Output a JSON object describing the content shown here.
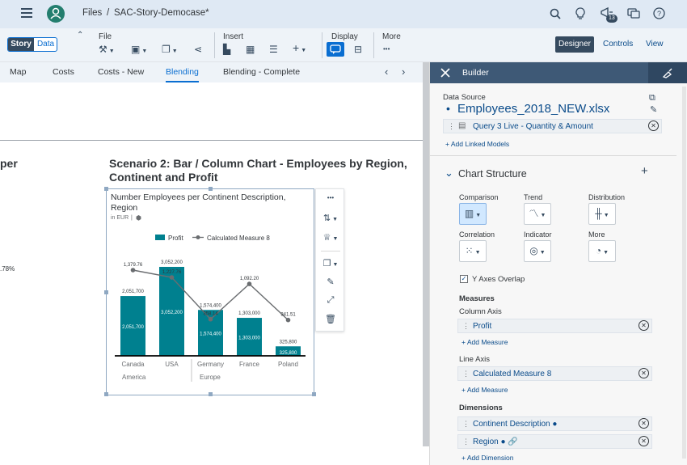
{
  "shell": {
    "menu_icon": "hamburger-icon",
    "nav_files": "Files",
    "nav_sep": "/",
    "story_title": "SAC-Story-Democase*",
    "notification_count": "13"
  },
  "toolbar": {
    "story_tab": "Story",
    "data_tab": "Data",
    "file_label": "File",
    "insert_label": "Insert",
    "display_label": "Display",
    "more_label": "More",
    "more_dots": "•••",
    "designer_label": "Designer",
    "controls_label": "Controls",
    "view_label": "View"
  },
  "tabs": [
    {
      "label": "Map"
    },
    {
      "label": "Costs"
    },
    {
      "label": "Costs - New"
    },
    {
      "label": "Blending"
    },
    {
      "label": "Blending - Complete"
    }
  ],
  "canvas": {
    "left_title_fragment": "per",
    "left_value_fragment": ".78%",
    "scenario_title_line1": "Scenario 2: Bar / Column Chart - Employees by Region,",
    "scenario_title_line2": "Continent and Profit"
  },
  "widget": {
    "title_line1": "Number Employees per Continent Description,",
    "title_line2": "Region",
    "unit": "in EUR",
    "unit_sep": "|"
  },
  "chart_data": {
    "type": "bar",
    "categories": [
      "Canada",
      "USA",
      "Germany",
      "France",
      "Poland"
    ],
    "groups": [
      {
        "label": "America",
        "categories": [
          "Canada",
          "USA"
        ]
      },
      {
        "label": "Europe",
        "categories": [
          "Germany",
          "France",
          "Poland"
        ]
      }
    ],
    "series": [
      {
        "name": "Profit",
        "type": "bar",
        "color": "#00808f",
        "values": [
          2051700,
          3052200,
          1574400,
          1303000,
          325800
        ],
        "labels": [
          "2,051,700",
          "3,052,200",
          "1,574,400",
          "1,303,000",
          "325,800"
        ]
      },
      {
        "name": "Calculated Measure 8",
        "type": "line",
        "color": "#6a6d70",
        "values": [
          1379.76,
          1227.76,
          358.14,
          1092.2,
          341.51
        ],
        "labels": [
          "1,379.76",
          "1,227.76",
          "358.14",
          "1,092.20",
          "341.51"
        ]
      }
    ],
    "legend_position": "top"
  },
  "builder": {
    "title": "Builder",
    "data_source_label": "Data Source",
    "data_source_name": "Employees_2018_NEW.xlsx",
    "query_label": "Query 3 Live - Quantity & Amount",
    "add_linked_models": "Add Linked Models",
    "chart_structure": "Chart Structure",
    "cat_comparison": "Comparison",
    "cat_trend": "Trend",
    "cat_distribution": "Distribution",
    "cat_correlation": "Correlation",
    "cat_indicator": "Indicator",
    "cat_more": "More",
    "y_axes_overlap": "Y Axes Overlap",
    "measures_heading": "Measures",
    "column_axis_label": "Column Axis",
    "column_axis_value": "Profit",
    "add_measure": "Add Measure",
    "line_axis_label": "Line Axis",
    "line_axis_value": "Calculated Measure 8",
    "dimensions_heading": "Dimensions",
    "dimension_1": "Continent Description",
    "dimension_2": "Region",
    "add_dimension": "Add Dimension"
  },
  "colors": {
    "shell_bg": "#dfe9f4",
    "accent": "#0a6ed1",
    "builder_header": "#3e5976",
    "bar": "#00808f"
  }
}
